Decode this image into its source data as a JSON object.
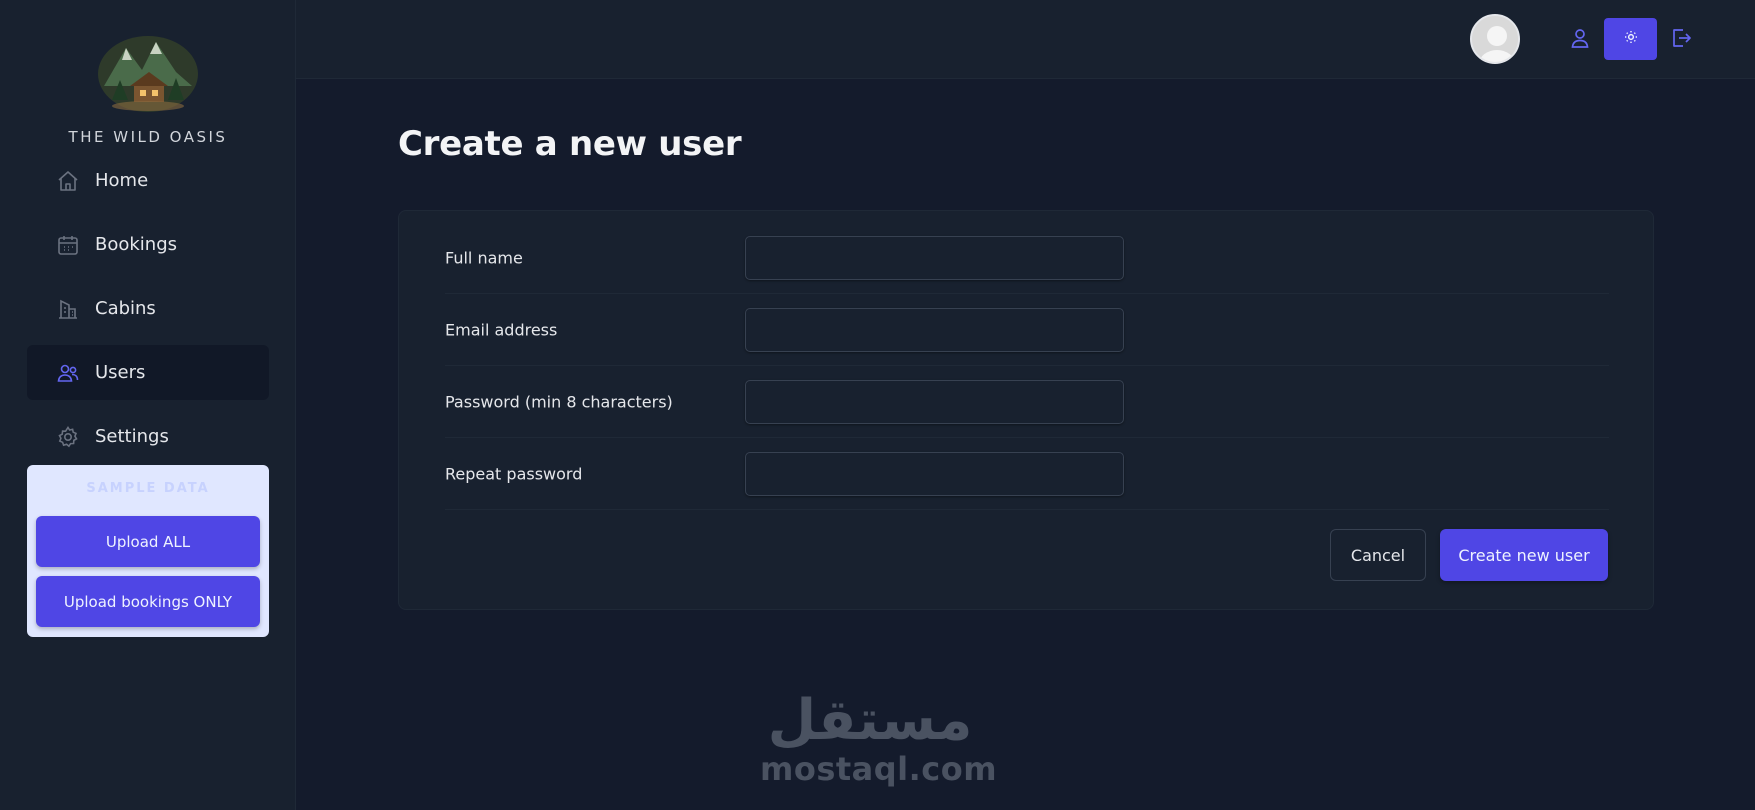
{
  "sidebar": {
    "brand": "THE WILD OASIS",
    "items": [
      {
        "label": "Home",
        "icon": "home-icon"
      },
      {
        "label": "Bookings",
        "icon": "calendar-icon"
      },
      {
        "label": "Cabins",
        "icon": "building-icon"
      },
      {
        "label": "Users",
        "icon": "users-icon",
        "active": true
      },
      {
        "label": "Settings",
        "icon": "gear-icon"
      }
    ],
    "sample": {
      "title": "SAMPLE DATA",
      "upload_all": "Upload ALL",
      "upload_bookings": "Upload bookings ONLY"
    }
  },
  "header": {
    "icons": [
      "avatar",
      "user-icon",
      "sun-icon",
      "logout-icon"
    ]
  },
  "main": {
    "title": "Create a new user",
    "form": {
      "fields": [
        {
          "label": "Full name",
          "value": ""
        },
        {
          "label": "Email address",
          "value": ""
        },
        {
          "label": "Password (min 8 characters)",
          "value": ""
        },
        {
          "label": "Repeat password",
          "value": ""
        }
      ],
      "cancel_label": "Cancel",
      "submit_label": "Create new user"
    }
  },
  "watermark": {
    "arabic": "مستقل",
    "latin": "mostaql.com"
  },
  "colors": {
    "accent": "#4f46e5",
    "background": "#141b2c",
    "panel": "#18212f"
  }
}
